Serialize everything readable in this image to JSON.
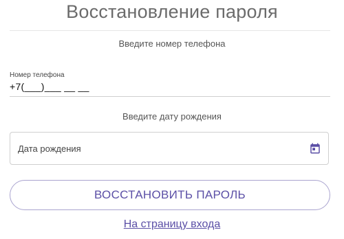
{
  "page": {
    "title": "Восстановление пароля"
  },
  "phone": {
    "hint": "Введите номер телефона",
    "label": "Номер телефона",
    "value": "+7(___)___ __ __"
  },
  "dob": {
    "hint": "Введите дату рождения",
    "placeholder": "Дата рождения",
    "icon": "calendar-icon"
  },
  "actions": {
    "restore_label": "ВОССТАНОВИТЬ ПАРОЛЬ",
    "login_link": "На страницу входа"
  },
  "colors": {
    "accent": "#5b4fa6",
    "title": "#6b6b6b"
  }
}
